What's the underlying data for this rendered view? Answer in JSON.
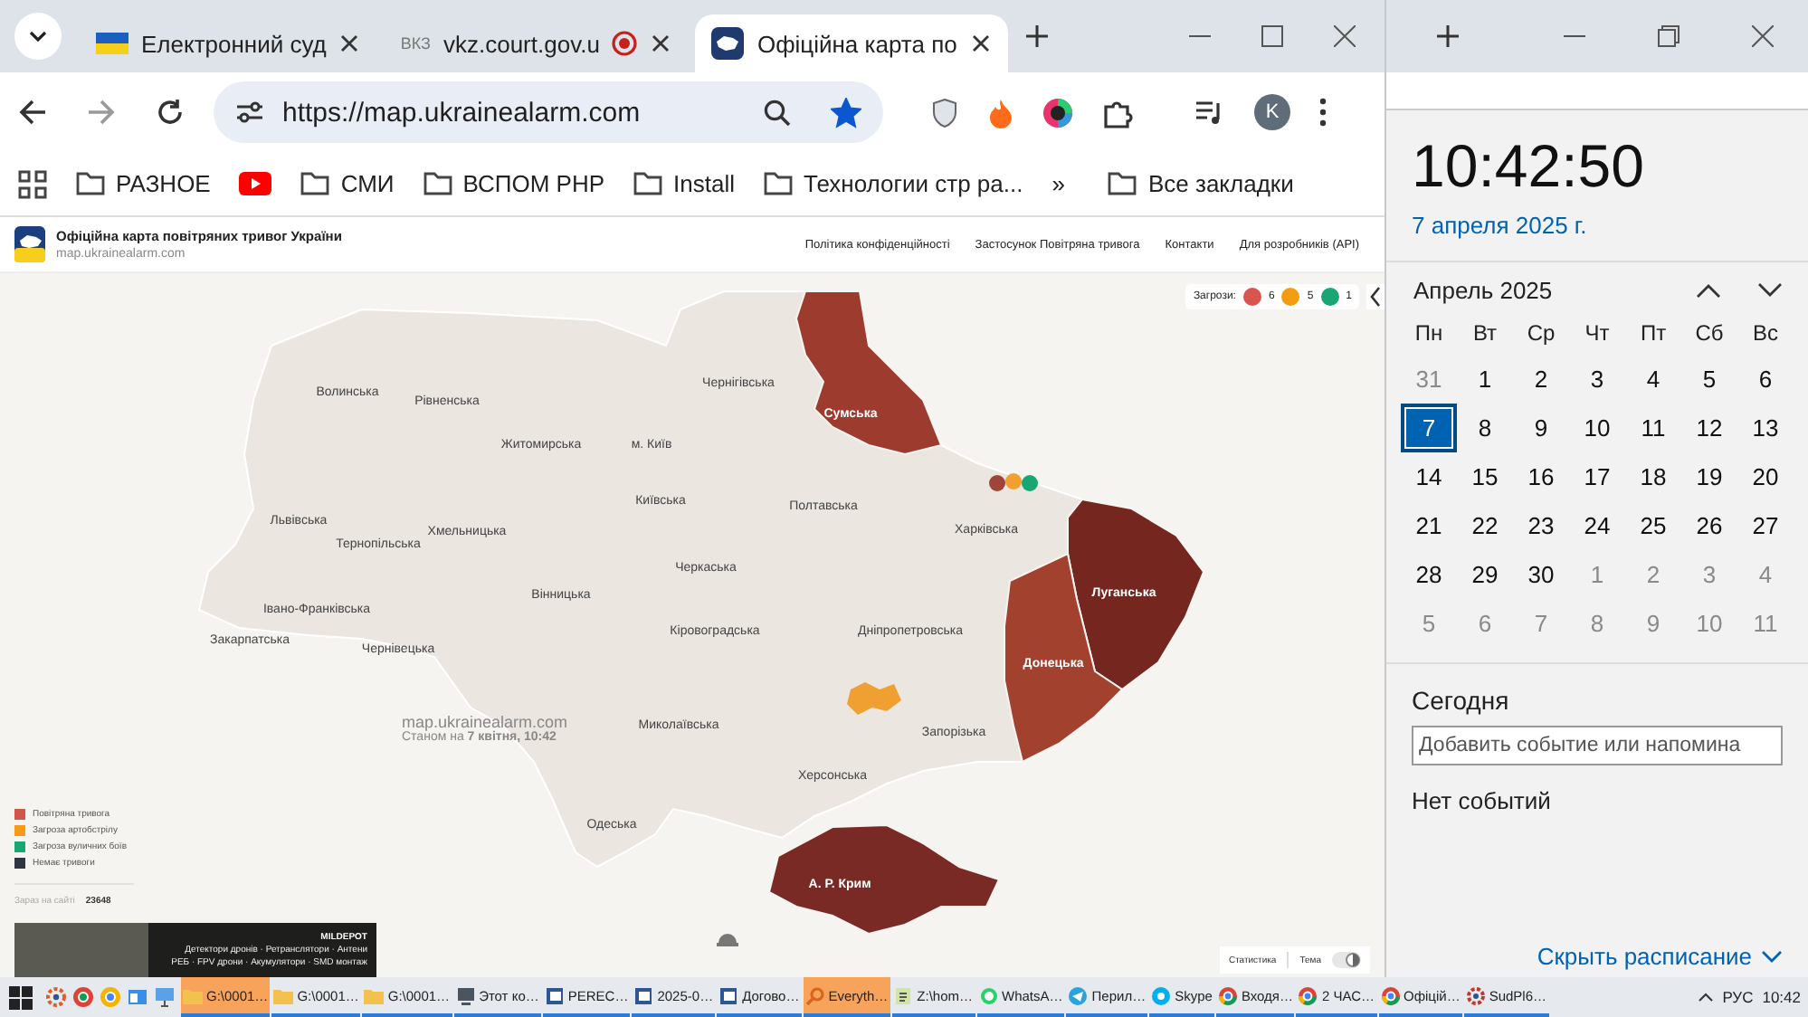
{
  "browser": {
    "tabs": [
      {
        "title": "Електронний суд",
        "kind": "flag",
        "recording": false,
        "selected": false
      },
      {
        "title": "vkz.court.gov.u",
        "kind": "text",
        "favicon_text": "ВКЗ",
        "recording": true,
        "selected": false
      },
      {
        "title": "Офіційна карта по",
        "kind": "logo",
        "recording": false,
        "selected": true
      }
    ],
    "url": "https://map.ukrainealarm.com",
    "bookmarked": true,
    "profile_initial": "K",
    "bookmarks": [
      {
        "kind": "apps"
      },
      {
        "kind": "folder",
        "label": "РАЗНОЕ"
      },
      {
        "kind": "video"
      },
      {
        "kind": "folder",
        "label": "СМИ"
      },
      {
        "kind": "folder",
        "label": "ВСПОМ РНР"
      },
      {
        "kind": "folder",
        "label": "Install"
      },
      {
        "kind": "folder",
        "label": "Технологии стр ра..."
      },
      {
        "kind": "more",
        "label": "»"
      },
      {
        "kind": "folder",
        "label": "Все закладки"
      }
    ]
  },
  "page": {
    "header": {
      "title": "Офіційна карта повітряних тривог України",
      "subtitle": "map.ukrainealarm.com",
      "nav": [
        "Політика конфіденційності",
        "Застосунок Повітряна тривога",
        "Контакти",
        "Для розробників (API)"
      ]
    },
    "threats": {
      "label": "Загрози:",
      "items": [
        {
          "count": "6",
          "color": "#d9534f"
        },
        {
          "count": "5",
          "color": "#f39c12"
        },
        {
          "count": "1",
          "color": "#1aa672"
        }
      ]
    },
    "regions": [
      {
        "name": "Волинська",
        "alert": false
      },
      {
        "name": "Рівненська",
        "alert": false
      },
      {
        "name": "Житомирська",
        "alert": false
      },
      {
        "name": "Чернігівська",
        "alert": false
      },
      {
        "name": "Сумська",
        "alert": true,
        "color": "#9e3b2f"
      },
      {
        "name": "м. Київ",
        "alert": false
      },
      {
        "name": "Київська",
        "alert": false
      },
      {
        "name": "Полтавська",
        "alert": false
      },
      {
        "name": "Харківська",
        "alert": false
      },
      {
        "name": "Львівська",
        "alert": false
      },
      {
        "name": "Тернопільська",
        "alert": false
      },
      {
        "name": "Хмельницька",
        "alert": false
      },
      {
        "name": "Вінницька",
        "alert": false
      },
      {
        "name": "Черкаська",
        "alert": false
      },
      {
        "name": "Луганська",
        "alert": true,
        "color": "#74261f"
      },
      {
        "name": "Івано-Франківська",
        "alert": false
      },
      {
        "name": "Закарпатська",
        "alert": false
      },
      {
        "name": "Чернівецька",
        "alert": false
      },
      {
        "name": "Кіровоградська",
        "alert": false
      },
      {
        "name": "Дніпропетровська",
        "alert": false
      },
      {
        "name": "Донецька",
        "alert": true,
        "color": "#a3412f"
      },
      {
        "name": "Миколаївська",
        "alert": false
      },
      {
        "name": "Запорізька",
        "alert": false
      },
      {
        "name": "Херсонська",
        "alert": false
      },
      {
        "name": "Одеська",
        "alert": false
      },
      {
        "name": "А. Р. Крим",
        "alert": true,
        "color": "#7a2a24"
      }
    ],
    "watermark": {
      "site": "map.ukrainealarm.com",
      "timestamp": "Станом на **7 квітня, 10:42**"
    },
    "legend": [
      {
        "label": "Повітряна тривога",
        "color": "#d0554a"
      },
      {
        "label": "Загроза артобстрілу",
        "color": "#f59a1b"
      },
      {
        "label": "Загроза вуличних боїв",
        "color": "#1aa672"
      },
      {
        "label": "Немає тривоги",
        "color": "#2f3640"
      }
    ],
    "online": {
      "label": "Зараз на сайті",
      "count": "23648"
    },
    "ad": {
      "brand": "MILDEPOT",
      "lines": [
        "Детектори дронів · Ретранслятори · Антени",
        "РЕБ · FPV дрони · Акумулятори · SMD монтаж"
      ]
    },
    "controls": {
      "statistics": "Статистика",
      "theme": "Тема"
    }
  },
  "calendar": {
    "time": "10:42:50",
    "date": "7 апреля 2025 г.",
    "month": "Апрель 2025",
    "weekdays": [
      "Пн",
      "Вт",
      "Ср",
      "Чт",
      "Пт",
      "Сб",
      "Вс"
    ],
    "days": [
      {
        "label": "31",
        "in_month": false,
        "selected": false
      },
      {
        "label": "1",
        "in_month": true,
        "selected": false
      },
      {
        "label": "2",
        "in_month": true,
        "selected": false
      },
      {
        "label": "3",
        "in_month": true,
        "selected": false
      },
      {
        "label": "4",
        "in_month": true,
        "selected": false
      },
      {
        "label": "5",
        "in_month": true,
        "selected": false
      },
      {
        "label": "6",
        "in_month": true,
        "selected": false
      },
      {
        "label": "7",
        "in_month": true,
        "selected": true
      },
      {
        "label": "8",
        "in_month": true,
        "selected": false
      },
      {
        "label": "9",
        "in_month": true,
        "selected": false
      },
      {
        "label": "10",
        "in_month": true,
        "selected": false
      },
      {
        "label": "11",
        "in_month": true,
        "selected": false
      },
      {
        "label": "12",
        "in_month": true,
        "selected": false
      },
      {
        "label": "13",
        "in_month": true,
        "selected": false
      },
      {
        "label": "14",
        "in_month": true,
        "selected": false
      },
      {
        "label": "15",
        "in_month": true,
        "selected": false
      },
      {
        "label": "16",
        "in_month": true,
        "selected": false
      },
      {
        "label": "17",
        "in_month": true,
        "selected": false
      },
      {
        "label": "18",
        "in_month": true,
        "selected": false
      },
      {
        "label": "19",
        "in_month": true,
        "selected": false
      },
      {
        "label": "20",
        "in_month": true,
        "selected": false
      },
      {
        "label": "21",
        "in_month": true,
        "selected": false
      },
      {
        "label": "22",
        "in_month": true,
        "selected": false
      },
      {
        "label": "23",
        "in_month": true,
        "selected": false
      },
      {
        "label": "24",
        "in_month": true,
        "selected": false
      },
      {
        "label": "25",
        "in_month": true,
        "selected": false
      },
      {
        "label": "26",
        "in_month": true,
        "selected": false
      },
      {
        "label": "27",
        "in_month": true,
        "selected": false
      },
      {
        "label": "28",
        "in_month": true,
        "selected": false
      },
      {
        "label": "29",
        "in_month": true,
        "selected": false
      },
      {
        "label": "30",
        "in_month": true,
        "selected": false
      },
      {
        "label": "1",
        "in_month": false,
        "selected": false
      },
      {
        "label": "2",
        "in_month": false,
        "selected": false
      },
      {
        "label": "3",
        "in_month": false,
        "selected": false
      },
      {
        "label": "4",
        "in_month": false,
        "selected": false
      },
      {
        "label": "5",
        "in_month": false,
        "selected": false
      },
      {
        "label": "6",
        "in_month": false,
        "selected": false
      },
      {
        "label": "7",
        "in_month": false,
        "selected": false
      },
      {
        "label": "8",
        "in_month": false,
        "selected": false
      },
      {
        "label": "9",
        "in_month": false,
        "selected": false
      },
      {
        "label": "10",
        "in_month": false,
        "selected": false
      },
      {
        "label": "11",
        "in_month": false,
        "selected": false
      }
    ],
    "today_label": "Сегодня",
    "event_placeholder": "Добавить событие или напомина",
    "no_events": "Нет событий",
    "hide_link": "Скрыть расписание"
  },
  "taskbar": {
    "items": [
      {
        "label": "G:\\0001…",
        "kind": "folder",
        "highlighted": true
      },
      {
        "label": "G:\\0001…",
        "kind": "folder",
        "highlighted": false
      },
      {
        "label": "G:\\0001…",
        "kind": "folder",
        "highlighted": false
      },
      {
        "label": "Этот ко…",
        "kind": "computer",
        "highlighted": false
      },
      {
        "label": "PEREC…",
        "kind": "document",
        "highlighted": false
      },
      {
        "label": "2025-0…",
        "kind": "document",
        "highlighted": false
      },
      {
        "label": "Догово…",
        "kind": "document",
        "highlighted": false
      },
      {
        "label": "Everyth…",
        "kind": "search",
        "highlighted": true
      },
      {
        "label": "Z:\\hom…",
        "kind": "notepad",
        "highlighted": false
      },
      {
        "label": "WhatsA…",
        "kind": "chat",
        "highlighted": false
      },
      {
        "label": "Перил…",
        "kind": "telegram",
        "highlighted": false
      },
      {
        "label": "Skype",
        "kind": "skype",
        "highlighted": false
      },
      {
        "label": "Входя…",
        "kind": "browser",
        "highlighted": false
      },
      {
        "label": "2 ЧАС…",
        "kind": "browser",
        "highlighted": false
      },
      {
        "label": "Офіцій…",
        "kind": "browser",
        "highlighted": false
      },
      {
        "label": "SudPl6…",
        "kind": "app",
        "highlighted": false
      }
    ],
    "language": "РУС",
    "time": "10:42"
  }
}
